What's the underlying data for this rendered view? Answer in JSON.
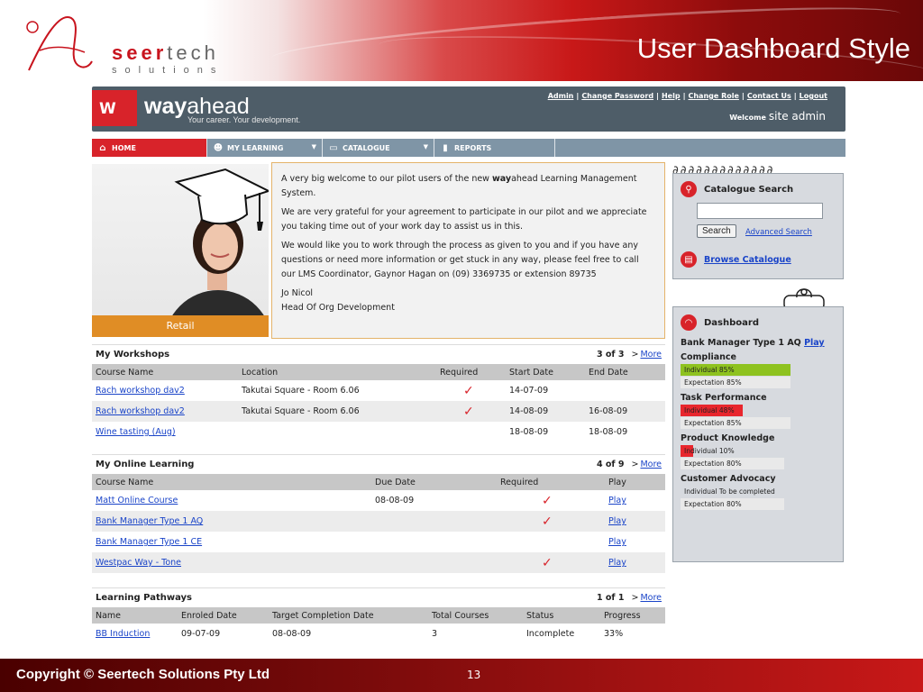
{
  "slide": {
    "title": "User Dashboard Style",
    "logo_word_a": "seer",
    "logo_word_b": "tech",
    "logo_sub": "solutions",
    "copyright": "Copyright © Seertech Solutions Pty Ltd",
    "page_number": "13"
  },
  "app": {
    "brand_name_bold": "way",
    "brand_name_rest": "ahead",
    "brand_tagline": "Your career. Your development.",
    "top_links": [
      "Admin",
      "Change Password",
      "Help",
      "Change Role",
      "Contact Us",
      "Logout"
    ],
    "welcome_label": "Welcome",
    "welcome_user": "site admin",
    "nav": [
      {
        "label": "HOME",
        "icon": "home-icon"
      },
      {
        "label": "MY LEARNING",
        "icon": "person-icon"
      },
      {
        "label": "CATALOGUE",
        "icon": "folder-icon"
      },
      {
        "label": "REPORTS",
        "icon": "bar-chart-icon"
      }
    ]
  },
  "hero": {
    "label": "Retail",
    "welcome_p1_a": "A very big welcome to our pilot users of the new ",
    "welcome_p1_b": "way",
    "welcome_p1_c": "ahead Learning Management System.",
    "welcome_p2": "We are very grateful for your agreement to participate in our pilot and we appreciate you taking time out of your work day to assist us in this.",
    "welcome_p3": "We would like you to work through the process as given to you and if you have any questions or need more information or get stuck in any way, please feel free to call our LMS Coordinator, Gaynor Hagan on (09) 3369735 or extension 89735",
    "signature_name": "Jo Nicol",
    "signature_title": "Head Of Org Development"
  },
  "workshops": {
    "title": "My Workshops",
    "page_info": "3 of 3",
    "more": "More",
    "columns": [
      "Course Name",
      "Location",
      "Required",
      "Start Date",
      "End Date"
    ],
    "rows": [
      {
        "name": "Rach workshop dav2",
        "location": "Takutai Square - Room 6.06",
        "required": true,
        "start": "14-07-09",
        "end": ""
      },
      {
        "name": "Rach workshop dav2",
        "location": "Takutai Square - Room 6.06",
        "required": true,
        "start": "14-08-09",
        "end": "16-08-09"
      },
      {
        "name": "Wine tasting (Aug)",
        "location": "",
        "required": false,
        "start": "18-08-09",
        "end": "18-08-09"
      }
    ]
  },
  "online": {
    "title": "My Online Learning",
    "page_info": "4 of 9",
    "more": "More",
    "columns": [
      "Course Name",
      "Due Date",
      "Required",
      "Play"
    ],
    "rows": [
      {
        "name": "Matt Online Course",
        "due": "08-08-09",
        "required": true,
        "play": "Play"
      },
      {
        "name": "Bank Manager Type 1 AQ",
        "due": "",
        "required": true,
        "play": "Play"
      },
      {
        "name": "Bank Manager Type 1 CE",
        "due": "",
        "required": false,
        "play": "Play"
      },
      {
        "name": "Westpac Way - Tone",
        "due": "",
        "required": true,
        "play": "Play"
      }
    ]
  },
  "pathways": {
    "title": "Learning Pathways",
    "page_info": "1 of 1",
    "more": "More",
    "columns": [
      "Name",
      "Enroled Date",
      "Target Completion Date",
      "Total Courses",
      "Status",
      "Progress"
    ],
    "rows": [
      {
        "name": "BB Induction",
        "enroled": "09-07-09",
        "target": "08-08-09",
        "total": "3",
        "status": "Incomplete",
        "progress": "33%"
      }
    ]
  },
  "catalogue": {
    "title": "Catalogue Search",
    "search_value": "",
    "search_button": "Search",
    "advanced_link": "Advanced Search",
    "browse_link": "Browse Catalogue"
  },
  "dashboard": {
    "title": "Dashboard",
    "plan_label": "Bank Manager Type 1 AQ",
    "plan_link": "Play",
    "categories": [
      {
        "name": "Compliance",
        "individual_label": "Individual 85%",
        "individual_value": 0.85,
        "individual_color": "#8ec21f",
        "expectation_label": "Expectation 85%",
        "expectation_value": 0.85
      },
      {
        "name": "Task Performance",
        "individual_label": "Individual 48%",
        "individual_value": 0.48,
        "individual_color": "#e8262d",
        "expectation_label": "Expectation 85%",
        "expectation_value": 0.85
      },
      {
        "name": "Product Knowledge",
        "individual_label": "Individual 10%",
        "individual_value": 0.1,
        "individual_color": "#e8262d",
        "expectation_label": "Expectation 80%",
        "expectation_value": 0.8
      },
      {
        "name": "Customer Advocacy",
        "individual_label": "Individual To be completed",
        "individual_value": 0,
        "individual_color": "#d7dadf",
        "expectation_label": "Expectation 80%",
        "expectation_value": 0.8
      }
    ]
  }
}
